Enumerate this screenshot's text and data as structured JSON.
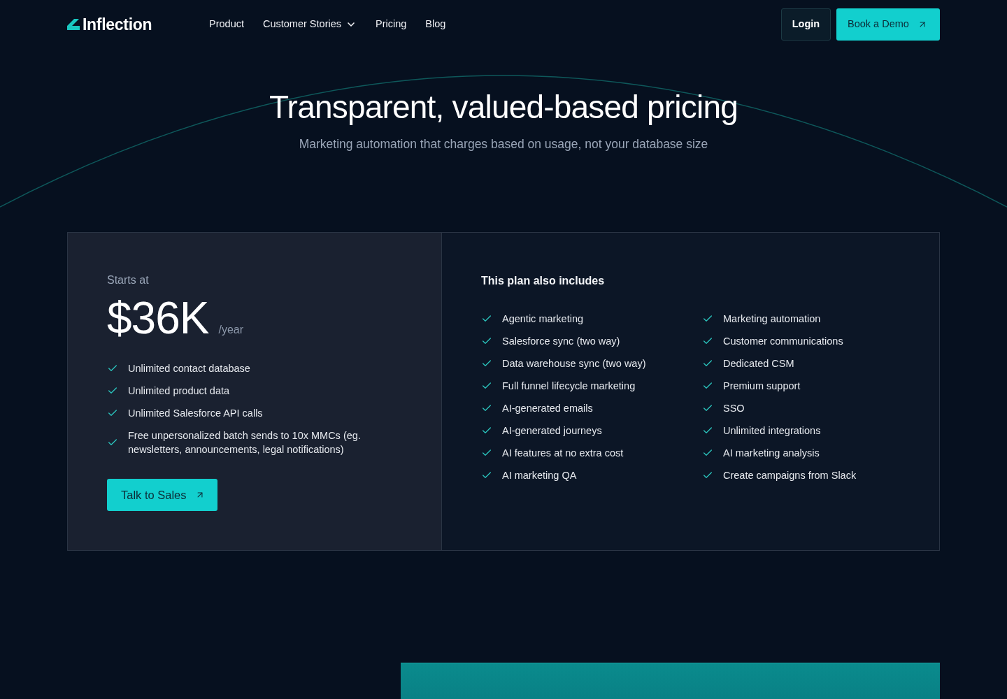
{
  "nav": {
    "logo": "Inflection",
    "links": [
      {
        "label": "Product",
        "dropdown": false
      },
      {
        "label": "Customer Stories",
        "dropdown": true
      },
      {
        "label": "Pricing",
        "dropdown": false
      },
      {
        "label": "Blog",
        "dropdown": false
      }
    ],
    "login": "Login",
    "demo_button": "Book a Demo"
  },
  "hero": {
    "title": "Transparent, valued-based pricing",
    "subtitle": "Marketing automation that charges based on usage, not your database size"
  },
  "plan": {
    "starts_label": "Starts at",
    "price": "$36K",
    "period": "/year",
    "features": [
      "Unlimited contact database",
      "Unlimited product data",
      "Unlimited Salesforce API calls",
      "Free unpersonalized batch sends to 10x MMCs (eg. newsletters, announcements, legal notifications)"
    ],
    "cta": "Talk to Sales"
  },
  "includes": {
    "title": "This plan also includes",
    "columns": [
      [
        "Agentic marketing",
        "Salesforce sync (two way)",
        "Data warehouse sync (two way)",
        "Full funnel lifecycle marketing",
        "AI-generated emails",
        "AI-generated journeys",
        "AI features at no extra cost",
        "AI marketing QA"
      ],
      [
        "Marketing automation",
        "Customer communications",
        "Dedicated CSM",
        "Premium support",
        "SSO",
        "Unlimited integrations",
        "AI marketing analysis",
        "Create campaigns from Slack"
      ]
    ]
  }
}
